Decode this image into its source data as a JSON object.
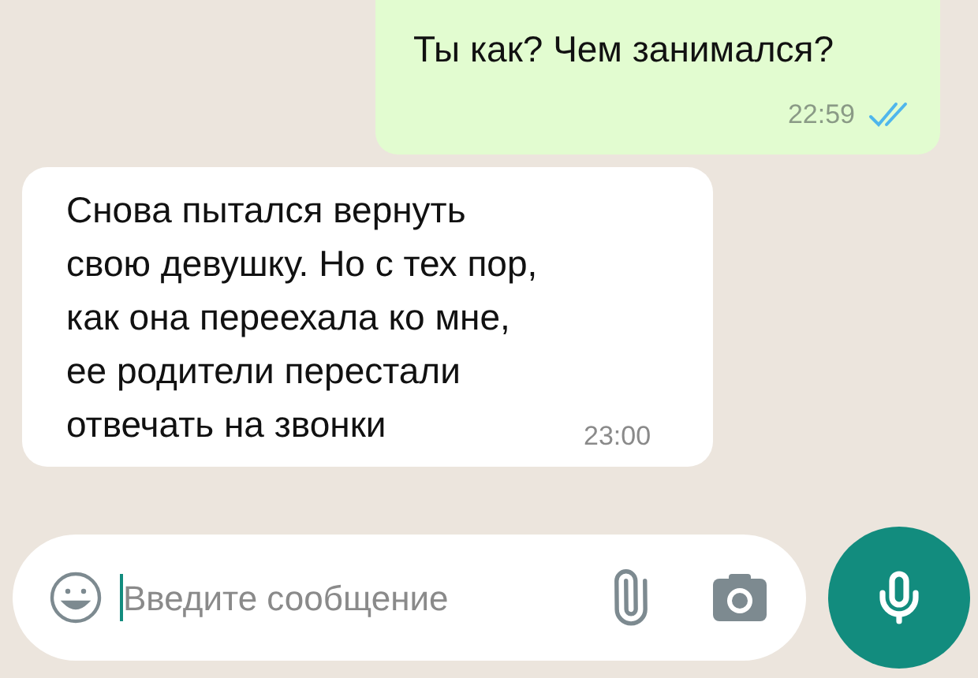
{
  "messages": [
    {
      "kind": "outgoing",
      "text": "Ты как? Чем занимался?",
      "time": "22:59",
      "read": true
    },
    {
      "kind": "incoming",
      "text": "Снова пытался вернуть свою девушку. Но с тех пор, как она переехала ко мне, ее родители перестали отвечать на звонки",
      "time": "23:00"
    }
  ],
  "composer": {
    "placeholder": "Введите сообщение"
  }
}
